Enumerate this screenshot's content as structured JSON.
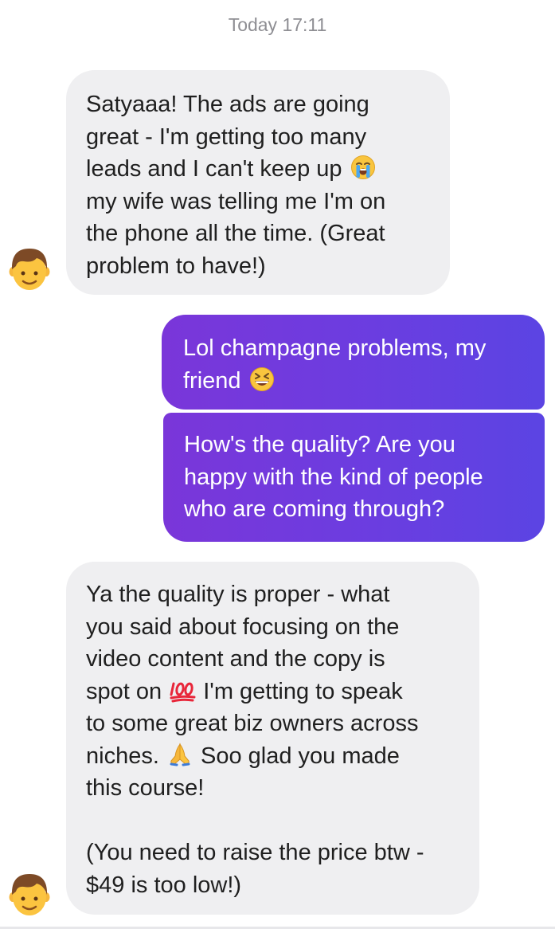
{
  "chat": {
    "timestamp": "Today 17:11",
    "messages": [
      {
        "direction": "incoming",
        "parts": [
          "Satyaaa! The ads are going\ngreat - I'm getting too many\nleads and I can't keep up ",
          "\nmy wife was telling me I'm on\nthe phone all the time. (Great\nproblem to have!)"
        ],
        "emojis": [
          "loudly-crying-face"
        ]
      },
      {
        "direction": "outgoing",
        "parts": [
          "Lol champagne problems, my\nfriend ",
          ""
        ],
        "emojis": [
          "grinning-squinting-face"
        ]
      },
      {
        "direction": "outgoing",
        "text": "How's the quality? Are you\nhappy with the kind of people\nwho are coming through?"
      },
      {
        "direction": "incoming",
        "parts": [
          "Ya the quality is proper - what\nyou said about focusing on the\nvideo content and the copy is\nspot on ",
          " I'm getting to speak\nto some great biz owners across\nniches. ",
          " Soo glad you made\nthis course!\n\n(You need to raise the price btw -\n$49 is too low!)"
        ],
        "emojis": [
          "hundred-points",
          "folded-hands"
        ]
      }
    ]
  },
  "colors": {
    "incoming_bubble": "#efeff1",
    "outgoing_gradient_start": "#7a36d9",
    "outgoing_gradient_end": "#5b44e3",
    "timestamp_text": "#8e8e93"
  }
}
